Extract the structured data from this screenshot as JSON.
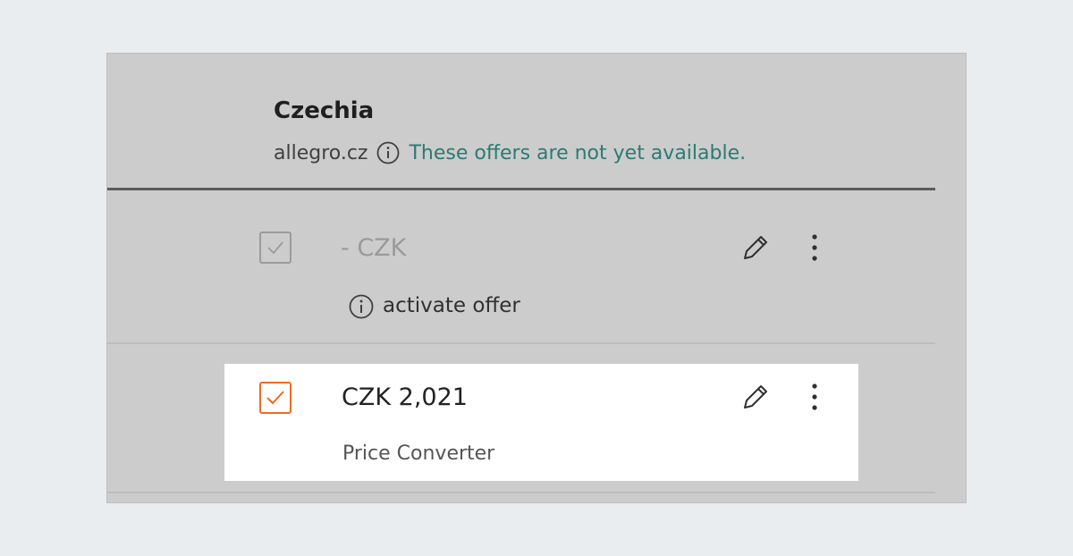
{
  "country": {
    "title": "Czechia",
    "marketplace": "allegro.cz",
    "notice": "These offers are not yet available.",
    "notice_color": "#2a7b74"
  },
  "offers": [
    {
      "checked": true,
      "state": "disabled",
      "price_label": "- CZK",
      "action_label": "activate offer",
      "action_icon": "info-icon",
      "edit_icon": "pencil-icon",
      "menu_icon": "more-vertical-icon"
    },
    {
      "checked": true,
      "state": "active",
      "price_label": "CZK 2,021",
      "source_label": "Price Converter",
      "edit_icon": "pencil-icon",
      "menu_icon": "more-vertical-icon",
      "checkbox_color": "#f06b23"
    }
  ]
}
